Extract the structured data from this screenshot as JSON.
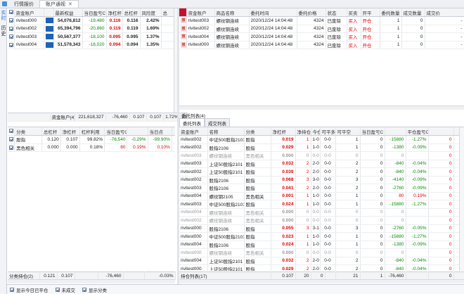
{
  "tabs": [
    {
      "label": "行情报价"
    },
    {
      "label": "账户通视"
    }
  ],
  "sidebar": [
    "实时",
    "历史"
  ],
  "accounts": {
    "headers": [
      "资金账户",
      "",
      "最新权益",
      "当日盈亏C",
      "净杠杆",
      "总杠杆",
      "风险度",
      "总"
    ],
    "rows": [
      {
        "acct": "rivitest000",
        "equity": "54,076,812",
        "pnl": "-19,480",
        "net": "0.116",
        "total": "0.116",
        "risk": "2.42%",
        "extra": "2"
      },
      {
        "acct": "rivitest002",
        "equity": "65,394,796",
        "pnl": "-20,860",
        "net": "0.119",
        "total": "0.119",
        "risk": "1.69%",
        "extra": "6"
      },
      {
        "acct": "rivitest003",
        "equity": "50,567,377",
        "pnl": "-18,100",
        "net": "0.095",
        "total": "0.095",
        "risk": "1.37%",
        "extra": "49"
      },
      {
        "acct": "rivitest004",
        "equity": "51,579,343",
        "pnl": "-18,020",
        "net": "0.094",
        "total": "0.094",
        "risk": "1.35%",
        "extra": "50"
      }
    ],
    "summary": {
      "label": "资金账户(4)",
      "equity": "221,618,327",
      "pnl": "-76,460",
      "net": "0.107",
      "total": "0.107",
      "risk": "1.72%",
      "extra": "21"
    }
  },
  "orders": {
    "headers": [
      "资金账户",
      "商品名称",
      "委托时间",
      "委托价格",
      "状态",
      "买卖",
      "开平",
      "委托数量",
      "成交数量",
      "成交价"
    ],
    "rows": [
      {
        "mark": "撤",
        "acct": "rivitest003",
        "name": "螺纹钢连续",
        "time": "2020/12/24 14:04:48",
        "price": "4324",
        "status": "已废除",
        "side": "买入",
        "oc": "开仓",
        "qty": "1",
        "filled": "0",
        "fprice": "-"
      },
      {
        "mark": "撤",
        "acct": "rivitest002",
        "name": "螺纹钢连续",
        "time": "2020/12/24 14:04:48",
        "price": "4324",
        "status": "已废除",
        "side": "买入",
        "oc": "开仓",
        "qty": "1",
        "filled": "0",
        "fprice": "-"
      },
      {
        "mark": "撤",
        "acct": "rivitest004",
        "name": "螺纹钢连续",
        "time": "2020/12/24 14:04:48",
        "price": "4324",
        "status": "已废除",
        "side": "买入",
        "oc": "开仓",
        "qty": "1",
        "filled": "0",
        "fprice": "-"
      },
      {
        "mark": "撤",
        "acct": "rivitest000",
        "name": "螺纹钢连续",
        "time": "2020/12/24 14:04:48",
        "price": "4324",
        "status": "已废除",
        "side": "买入",
        "oc": "开仓",
        "qty": "1",
        "filled": "0",
        "fprice": "-"
      }
    ],
    "count_label": "委托列表(4)",
    "subtabs": [
      "委托列表",
      "成交列表"
    ]
  },
  "categories": {
    "headers": [
      "分类",
      "总杠杆",
      "净杠杆",
      "杠杆利用",
      "当日盈亏C",
      "",
      "当日点"
    ],
    "rows": [
      {
        "name": "股指",
        "total": "0.120",
        "net": "0.107",
        "util": "99.82%",
        "pnl": "-76,540",
        "pct": "-0.29%",
        "chg": "-99.90%",
        "extra": "-0.03"
      },
      {
        "name": "黑色相关",
        "total": "0.000",
        "net": "0.000",
        "util": "0.18%",
        "pnl": "80",
        "pct": "0.19%",
        "chg": "0.10%",
        "extra": "0.00"
      }
    ],
    "summary": {
      "label": "分类持仓(2)",
      "total": "0.121",
      "net": "0.107",
      "pnl": "-76,460",
      "extra": "-0.03%"
    }
  },
  "positions": {
    "headers": [
      "资金账户",
      "名称",
      "分类",
      "净杠杆",
      "净持仓",
      "今仓",
      "可平多",
      "可平空",
      "当日盈亏C",
      "",
      "平仓盈亏C"
    ],
    "rows": [
      {
        "acct": "rivitest002",
        "name": "中证500股指2101",
        "cat": "股指",
        "lev": "0.019",
        "qty": "1",
        "today": "1-0",
        "td2": "0-0",
        "long": "1",
        "short": "0",
        "pnl": "-15880",
        "pct": "-1.27%",
        "close": "0",
        "dim": false
      },
      {
        "acct": "rivitest002",
        "name": "股指2106",
        "cat": "股指",
        "lev": "0.029",
        "qty": "1",
        "today": "1-0",
        "td2": "0-0",
        "long": "1",
        "short": "0",
        "pnl": "-1380",
        "pct": "-0.09%",
        "close": "0",
        "dim": false
      },
      {
        "acct": "rivitest003",
        "name": "螺纹钢连续",
        "cat": "黑色相关",
        "lev": "0.000",
        "qty": "0",
        "today": "0-0",
        "td2": "0-0",
        "long": "0",
        "short": "0",
        "pnl": "0",
        "pct": "",
        "close": "0",
        "dim": true
      },
      {
        "acct": "rivitest003",
        "name": "上证50股指2101",
        "cat": "股指",
        "lev": "0.032",
        "qty": "2",
        "today": "2-0",
        "td2": "0-0",
        "long": "2",
        "short": "0",
        "pnl": "-840",
        "pct": "-0.04%",
        "close": "0",
        "dim": false
      },
      {
        "acct": "rivitest002",
        "name": "上证50股指2101",
        "cat": "股指",
        "lev": "0.039",
        "qty": "2",
        "today": "2-0",
        "td2": "0-0",
        "long": "2",
        "short": "0",
        "pnl": "-840",
        "pct": "-0.04%",
        "close": "0",
        "dim": false
      },
      {
        "acct": "rivitest002",
        "name": "股指2106",
        "cat": "股指",
        "lev": "0.068",
        "qty": "3",
        "today": "3-0",
        "td2": "0-0",
        "long": "3",
        "short": "0",
        "pnl": "-4140",
        "pct": "-0.09%",
        "close": "0",
        "dim": false
      },
      {
        "acct": "rivitest003",
        "name": "股指2106",
        "cat": "股指",
        "lev": "0.041",
        "qty": "2",
        "today": "2-0",
        "td2": "0-0",
        "long": "2",
        "short": "0",
        "pnl": "-2760",
        "pct": "-0.09%",
        "close": "0",
        "dim": false
      },
      {
        "acct": "rivitest004",
        "name": "螺纹钢2105",
        "cat": "黑色相关",
        "lev": "0.001",
        "qty": "1",
        "today": "1-0",
        "td2": "0-0",
        "long": "1",
        "short": "0",
        "pnl": "80",
        "pct": "0.19%",
        "close": "0",
        "dim": false
      },
      {
        "acct": "rivitest003",
        "name": "中证500股指2101",
        "cat": "股指",
        "lev": "0.024",
        "qty": "1",
        "today": "1-0",
        "td2": "0-0",
        "long": "1",
        "short": "0",
        "pnl": "-15880",
        "pct": "-1.27%",
        "close": "0",
        "dim": false
      },
      {
        "acct": "rivitest004",
        "name": "螺纹钢连续",
        "cat": "黑色相关",
        "lev": "0.000",
        "qty": "0",
        "today": "0-0",
        "td2": "0-0",
        "long": "0",
        "short": "0",
        "pnl": "0",
        "pct": "",
        "close": "0",
        "dim": true
      },
      {
        "acct": "rivitest002",
        "name": "螺纹钢连续",
        "cat": "黑色相关",
        "lev": "0.000",
        "qty": "0",
        "today": "0-0",
        "td2": "0-0",
        "long": "0",
        "short": "0",
        "pnl": "0",
        "pct": "",
        "close": "0",
        "dim": true
      },
      {
        "acct": "rivitest000",
        "name": "股指2106",
        "cat": "股指",
        "lev": "0.055",
        "qty": "3",
        "today": "3-1",
        "td2": "0-0",
        "long": "3",
        "short": "0",
        "pnl": "-2760",
        "pct": "-0.05%",
        "close": "0",
        "dim": false
      },
      {
        "acct": "rivitest000",
        "name": "中证500股指2101",
        "cat": "股指",
        "lev": "0.023",
        "qty": "1",
        "today": "1-0",
        "td2": "0-0",
        "long": "1",
        "short": "0",
        "pnl": "-15880",
        "pct": "-1.27%",
        "close": "0",
        "dim": false
      },
      {
        "acct": "rivitest004",
        "name": "股指2106",
        "cat": "股指",
        "lev": "0.024",
        "qty": "1",
        "today": "1-0",
        "td2": "0-0",
        "long": "1",
        "short": "0",
        "pnl": "-1380",
        "pct": "-0.09%",
        "close": "0",
        "dim": false
      },
      {
        "acct": "rivitest000",
        "name": "螺纹钢连续",
        "cat": "黑色相关",
        "lev": "0.000",
        "qty": "0",
        "today": "0-0",
        "td2": "0-0",
        "long": "0",
        "short": "0",
        "pnl": "0",
        "pct": "",
        "close": "0",
        "dim": true
      },
      {
        "acct": "rivitest004",
        "name": "上证50股指2101",
        "cat": "股指",
        "lev": "0.032",
        "qty": "2",
        "today": "2-0",
        "td2": "0-0",
        "long": "2",
        "short": "0",
        "pnl": "-840",
        "pct": "-0.04%",
        "close": "0",
        "dim": false
      },
      {
        "acct": "rivitest000",
        "name": "上证50股指2101",
        "cat": "股指",
        "lev": "0.029",
        "qty": "2",
        "today": "2-0",
        "td2": "0-0",
        "long": "2",
        "short": "0",
        "pnl": "-840",
        "pct": "-0.04%",
        "close": "0",
        "dim": false
      }
    ],
    "summary": {
      "label": "持仓列表(17)",
      "lev": "0.107",
      "qty": "20",
      "today": "0",
      "long": "21",
      "short": "1",
      "pnl": "-76,460",
      "close": "0"
    }
  },
  "footer": {
    "options": [
      {
        "label": "显示今日已平仓",
        "checked": true
      },
      {
        "label": "未成交",
        "checked": true
      },
      {
        "label": "显示分类",
        "checked": true
      }
    ]
  },
  "colors": {
    "up": "#e00000",
    "down": "#0a8a0a",
    "accent": "#2a6fdb"
  }
}
